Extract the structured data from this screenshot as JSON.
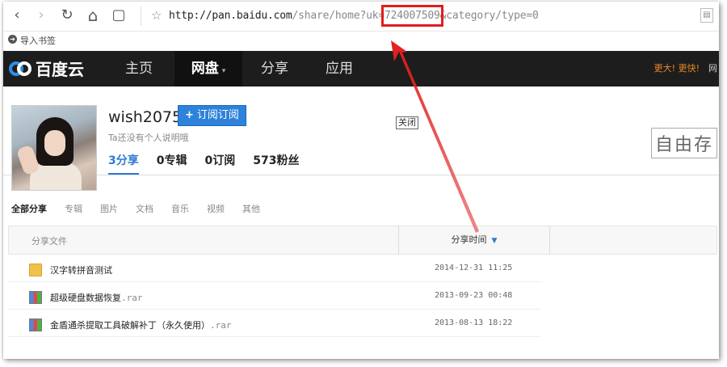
{
  "browser": {
    "nav": {
      "back": "‹",
      "forward": "›",
      "reload": "↻",
      "home": "⌂",
      "reader": "▢"
    },
    "url_host": "http://pan.baidu.com",
    "url_path_before": "/share/home?uk=",
    "url_highlight": "724007509",
    "url_after": "&category/type=0",
    "bookmark_label": "导入书签"
  },
  "site_nav": {
    "logo_text": "百度云",
    "items": [
      "主页",
      "网盘",
      "分享",
      "应用"
    ],
    "active_item": "网盘",
    "right_text": "更大! 更快!",
    "edge_text": "网"
  },
  "profile": {
    "username": "wish2075",
    "subscribe_label": "订阅订阅",
    "tooltip": "关闭",
    "description": "Ta还没有个人说明哦",
    "stats": [
      "3分享",
      "0专辑",
      "0订阅",
      "573粉丝"
    ],
    "watermark": "自由存"
  },
  "categories": [
    "全部分享",
    "专辑",
    "图片",
    "文档",
    "音乐",
    "视频",
    "其他"
  ],
  "table": {
    "col_name": "分享文件",
    "col_time": "分享时间",
    "rows": [
      {
        "type": "folder",
        "name": "汉字转拼音测试",
        "ext": "",
        "time": "2014-12-31 11:25"
      },
      {
        "type": "rar",
        "name": "超级硬盘数据恢复",
        "ext": ".rar",
        "time": "2013-09-23 00:48"
      },
      {
        "type": "rar",
        "name": "金盾通杀提取工具破解补丁（永久使用）",
        "ext": ".rar",
        "time": "2013-08-13 18:22"
      }
    ]
  },
  "colors": {
    "accent": "#2e7ad1",
    "highlight_box": "#e21d1d",
    "nav_bg": "#1d1d1d"
  }
}
